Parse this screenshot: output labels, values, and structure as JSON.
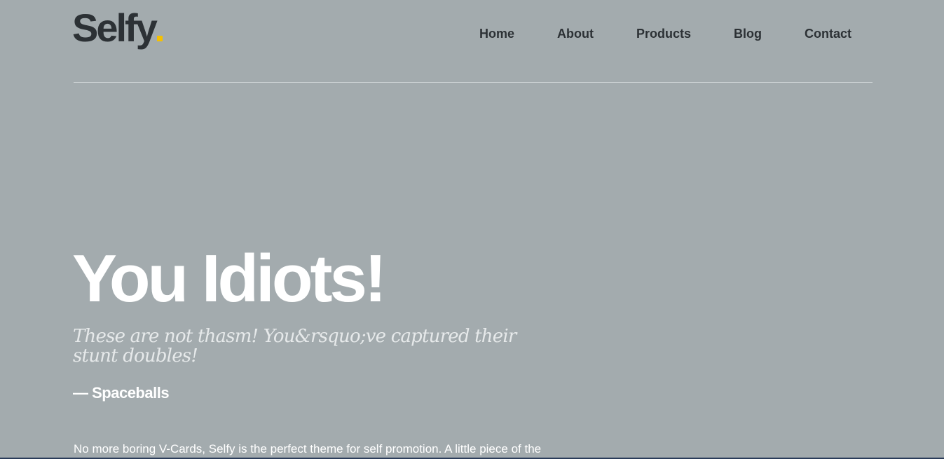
{
  "header": {
    "logo_text": "Selfy",
    "logo_dot_color": "#f5c000",
    "nav": [
      {
        "label": "Home"
      },
      {
        "label": "About"
      },
      {
        "label": "Products"
      },
      {
        "label": "Blog"
      },
      {
        "label": "Contact"
      }
    ]
  },
  "hero": {
    "headline": "You Idiots!",
    "quote": "These are not thasm! You&rsquo;ve captured their stunt doubles!",
    "citation": "— Spaceballs"
  },
  "intro": {
    "text": "No more boring V-Cards, Selfy is the perfect theme for self promotion. A little piece of the"
  },
  "colors": {
    "background": "#a3abae",
    "text_dark": "#2c3135",
    "text_light": "#ffffff",
    "accent": "#f5c000"
  }
}
